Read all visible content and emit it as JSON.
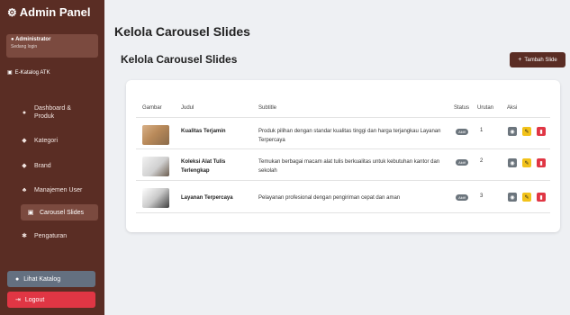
{
  "sidebar": {
    "brand": "Admin Panel",
    "brand_icon": "gears-icon",
    "user_name": "Administrator",
    "user_status": "Sedang login",
    "catalog_link": "E-Katalog ATK",
    "items": [
      {
        "label": "Dashboard &",
        "label2": "Produk",
        "icon": "speedometer-icon"
      },
      {
        "label": "Kategori",
        "icon": "tag-icon"
      },
      {
        "label": "Brand",
        "icon": "bookmark-icon"
      },
      {
        "label": "Manajemen User",
        "icon": "users-icon"
      },
      {
        "label": "Carousel Slides",
        "icon": "images-icon",
        "active": true
      },
      {
        "label": "Pengaturan",
        "icon": "gear-icon"
      }
    ],
    "view_catalog": "Lihat Katalog",
    "logout": "Logout"
  },
  "main": {
    "page_title": "Kelola Carousel Slides",
    "section_title": "Kelola Carousel Slides",
    "add_button": "Tambah Slide",
    "columns": [
      "Gambar",
      "Judul",
      "Subtitle",
      "Status",
      "Urutan",
      "Aksi"
    ],
    "rows": [
      {
        "title": "Kualitas Terjamin",
        "subtitle": "Produk pilihan dengan standar kualitas tinggi dan harga terjangkau Layanan Terpercaya",
        "status": "Aktif",
        "order": "1"
      },
      {
        "title": "Koleksi Alat Tulis Terlengkap",
        "subtitle": "Temukan berbagai macam alat tulis berkualitas untuk kebutuhan kantor dan sekolah",
        "status": "Aktif",
        "order": "2"
      },
      {
        "title": "Layanan Terpercaya",
        "subtitle": "Pelayanan profesional dengan pengiriman cepat dan aman",
        "status": "Aktif",
        "order": "3"
      }
    ]
  },
  "colors": {
    "sidebar_bg": "#5a2d24",
    "active_item_bg": "#7b4a3f",
    "logout_bg": "#e03644",
    "edit_bg": "#f2c21a",
    "view_bg": "#6c757d"
  }
}
